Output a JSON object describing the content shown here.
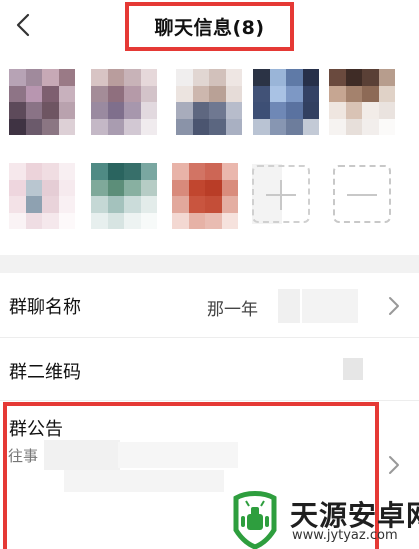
{
  "header": {
    "title": "聊天信息(8)",
    "back_icon": "chevron-left-icon"
  },
  "members": {
    "count_shown": 8,
    "add_icon": "plus-icon",
    "remove_icon": "minus-icon"
  },
  "rows": {
    "group_name": {
      "label": "群聊名称",
      "value": "那一年"
    },
    "qr_code": {
      "label": "群二维码"
    },
    "announcement": {
      "label": "群公告",
      "preview": "往事"
    }
  },
  "watermark": {
    "cn": "天源安卓网",
    "url": "www.jytyaz.com"
  },
  "colors": {
    "highlight_border": "#e53935",
    "section_gap": "#f2f2f2",
    "logo_green": "#2e9e3e"
  }
}
